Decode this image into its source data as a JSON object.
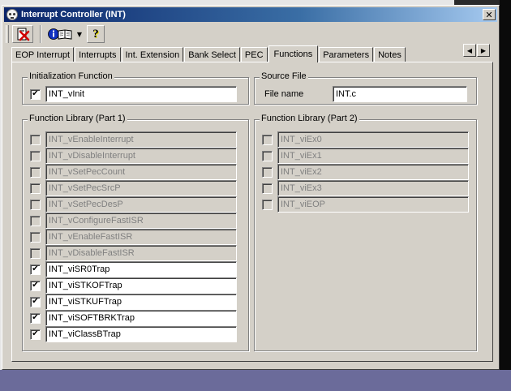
{
  "window": {
    "title": "Interrupt Controller (INT)",
    "close_glyph": "✕"
  },
  "toolbar": {
    "exit_icon": "exit-icon",
    "info_icon": "info-book-icon",
    "dropdown_glyph": "▼",
    "help_glyph": "?"
  },
  "tabs": [
    {
      "label": "EOP Interrupt",
      "active": false
    },
    {
      "label": "Interrupts",
      "active": false
    },
    {
      "label": "Int. Extension",
      "active": false
    },
    {
      "label": "Bank Select",
      "active": false
    },
    {
      "label": "PEC",
      "active": false
    },
    {
      "label": "Functions",
      "active": true
    },
    {
      "label": "Parameters",
      "active": false
    },
    {
      "label": "Notes",
      "active": false
    }
  ],
  "tab_scroll": {
    "left": "◀",
    "right": "▶"
  },
  "init_group": {
    "legend": "Initialization Function",
    "item": {
      "label": "INT_vInit",
      "checked": true,
      "enabled": true
    }
  },
  "source_group": {
    "legend": "Source File",
    "file_label": "File name",
    "file_value": "INT.c"
  },
  "lib1": {
    "legend": "Function Library (Part 1)",
    "items": [
      {
        "label": "INT_vEnableInterrupt",
        "checked": false,
        "enabled": false
      },
      {
        "label": "INT_vDisableInterrupt",
        "checked": false,
        "enabled": false
      },
      {
        "label": "INT_vSetPecCount",
        "checked": false,
        "enabled": false
      },
      {
        "label": "INT_vSetPecSrcP",
        "checked": false,
        "enabled": false
      },
      {
        "label": "INT_vSetPecDesP",
        "checked": false,
        "enabled": false
      },
      {
        "label": "INT_vConfigureFastISR",
        "checked": false,
        "enabled": false
      },
      {
        "label": "INT_vEnableFastISR",
        "checked": false,
        "enabled": false
      },
      {
        "label": "INT_vDisableFastISR",
        "checked": false,
        "enabled": false
      },
      {
        "label": "INT_viSR0Trap",
        "checked": true,
        "enabled": true
      },
      {
        "label": "INT_viSTKOFTrap",
        "checked": true,
        "enabled": true
      },
      {
        "label": "INT_viSTKUFTrap",
        "checked": true,
        "enabled": true
      },
      {
        "label": "INT_viSOFTBRKTrap",
        "checked": true,
        "enabled": true
      },
      {
        "label": "INT_viClassBTrap",
        "checked": true,
        "enabled": true
      }
    ]
  },
  "lib2": {
    "legend": "Function Library (Part 2)",
    "items": [
      {
        "label": "INT_viEx0",
        "checked": false,
        "enabled": false
      },
      {
        "label": "INT_viEx1",
        "checked": false,
        "enabled": false
      },
      {
        "label": "INT_viEx2",
        "checked": false,
        "enabled": false
      },
      {
        "label": "INT_viEx3",
        "checked": false,
        "enabled": false
      },
      {
        "label": "INT_viEOP",
        "checked": false,
        "enabled": false
      }
    ]
  }
}
